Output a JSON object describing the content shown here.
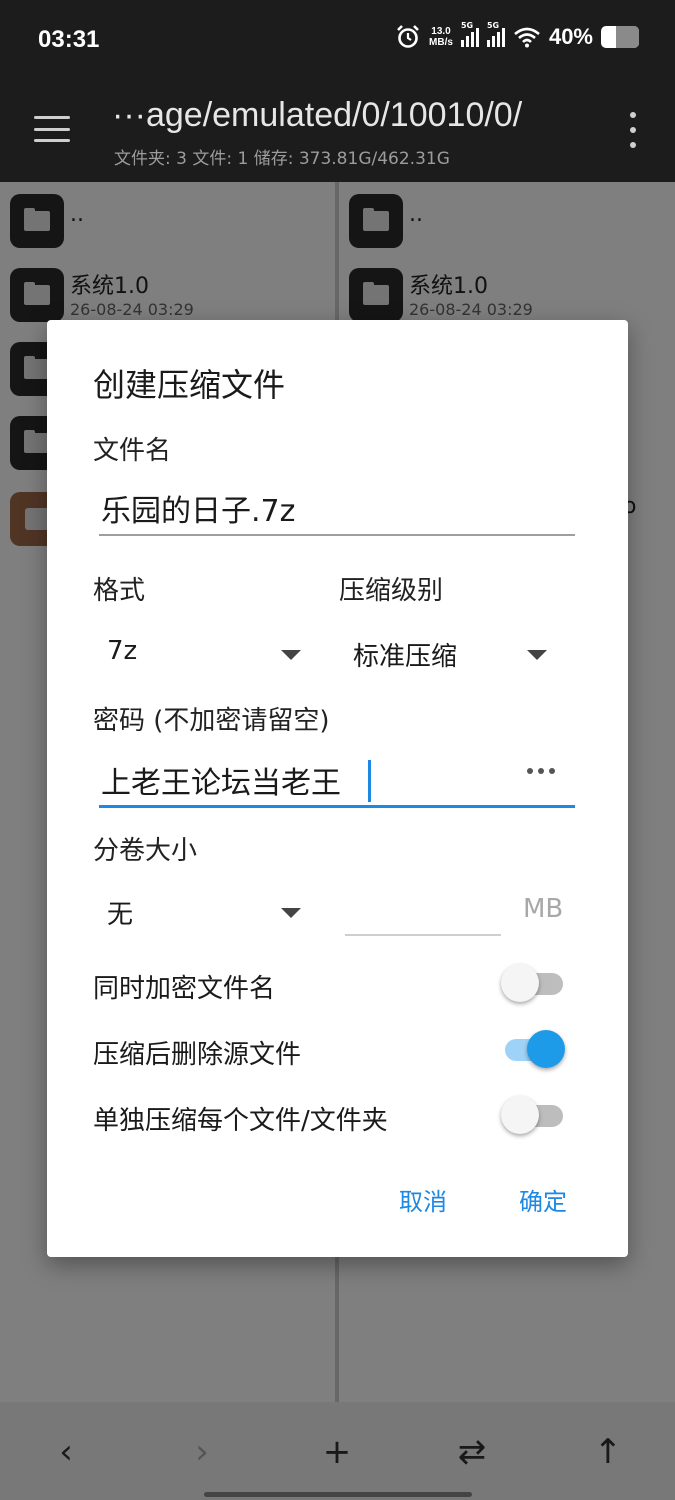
{
  "status": {
    "time": "03:31",
    "net_speed_value": "13.0",
    "net_speed_unit": "MB/s",
    "sim1_label": "5G",
    "sim2_label": "5G",
    "battery_percent": "40%",
    "battery_level": 0.4,
    "icons": [
      "alarm-icon",
      "signal-icon",
      "signal-icon",
      "wifi-icon",
      "battery-icon"
    ]
  },
  "app_bar": {
    "path": "···age/emulated/0/10010/0/",
    "summary": "文件夹: 3  文件: 1  储存: 373.81G/462.31G"
  },
  "left_pane": {
    "items": [
      {
        "name": "..",
        "date": "",
        "icon": "folder-icon"
      },
      {
        "name": "系统1.0",
        "date": "26-08-24 03:29",
        "icon": "folder-icon"
      }
    ]
  },
  "right_pane": {
    "items": [
      {
        "name": "..",
        "date": "",
        "icon": "folder-icon"
      },
      {
        "name": "系统1.0",
        "date": "26-08-24 03:29",
        "icon": "folder-icon"
      }
    ],
    "partial_text": "o"
  },
  "dialog": {
    "title": "创建压缩文件",
    "filename_label": "文件名",
    "filename_value": "乐园的日子.7z",
    "format_label": "格式",
    "format_value": "7z",
    "level_label": "压缩级别",
    "level_value": "标准压缩",
    "password_label": "密码 (不加密请留空)",
    "password_value": "上老王论坛当老王",
    "volume_label": "分卷大小",
    "volume_value": "无",
    "volume_unit": "MB",
    "options": [
      {
        "label": "同时加密文件名",
        "on": false
      },
      {
        "label": "压缩后删除源文件",
        "on": true
      },
      {
        "label": "单独压缩每个文件/文件夹",
        "on": false
      }
    ],
    "cancel_label": "取消",
    "ok_label": "确定"
  },
  "bottom_bar": {
    "buttons": [
      "back-icon",
      "forward-icon",
      "add-icon",
      "swap-icon",
      "up-icon"
    ]
  },
  "colors": {
    "accent": "#1e88e5",
    "switch_on": "#1e9be8",
    "dark_bar": "#1c1c1c"
  }
}
